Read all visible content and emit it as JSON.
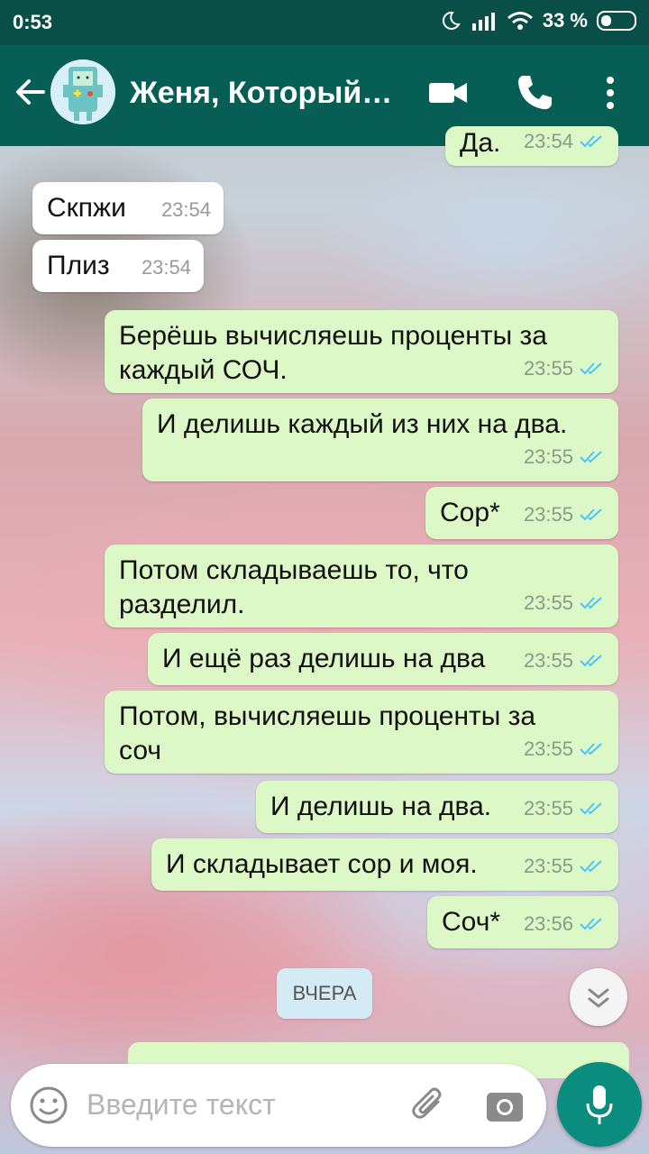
{
  "status_bar": {
    "time": "0:53",
    "battery": "33 %"
  },
  "toolbar": {
    "title": "Женя, Который…"
  },
  "messages": [
    {
      "text": "Да.",
      "time": "23:54"
    },
    {
      "text": "Скпжи",
      "time": "23:54"
    },
    {
      "text": "Плиз",
      "time": "23:54"
    },
    {
      "text_lines": [
        "Берёшь вычисляешь проценты за",
        "каждый СОЧ."
      ],
      "time": "23:55"
    },
    {
      "text": "И делишь каждый из них на два.",
      "time": "23:55"
    },
    {
      "text": "Сор*",
      "time": "23:55"
    },
    {
      "text_lines": [
        "Потом складываешь то, что",
        "разделил."
      ],
      "time": "23:55"
    },
    {
      "text": "И ещё раз делишь на два",
      "time": "23:55"
    },
    {
      "text_lines": [
        "Потом, вычисляешь проценты за",
        "соч"
      ],
      "time": "23:55"
    },
    {
      "text": "И делишь на два.",
      "time": "23:55"
    },
    {
      "text": "И складывает сор и моя.",
      "time": "23:55"
    },
    {
      "text": "Соч*",
      "time": "23:56"
    }
  ],
  "date_separator": "ВЧЕРА",
  "composer": {
    "placeholder": "Введите текст"
  },
  "colors": {
    "toolbar": "#075e54",
    "status_bar": "#0a4f47",
    "outgoing_bubble": "#dcf8c6",
    "incoming_bubble": "#ffffff",
    "read_ticks": "#4fc3f7",
    "mic_button": "#0a8d7e"
  },
  "icons": [
    "back-arrow-icon",
    "video-call-icon",
    "phone-icon",
    "more-vert-icon",
    "emoji-icon",
    "attach-icon",
    "camera-icon",
    "mic-icon",
    "scroll-down-icon",
    "moon-icon",
    "signal-icon",
    "wifi-icon",
    "battery-icon"
  ]
}
